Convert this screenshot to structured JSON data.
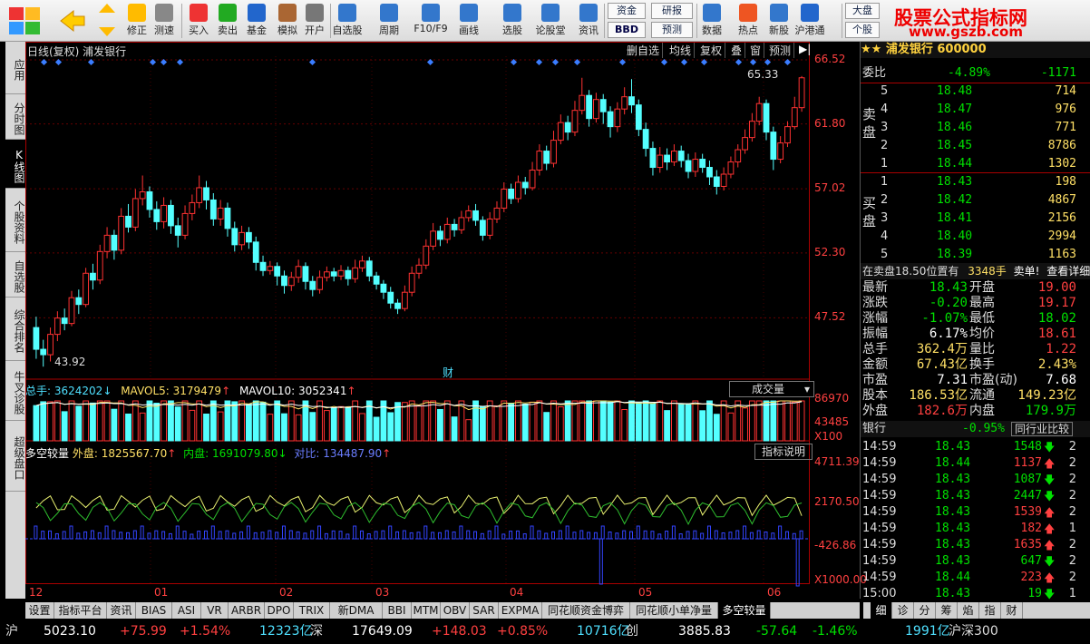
{
  "toolbar": {
    "buttons": [
      {
        "label": "修正",
        "icon": "refresh-icon"
      },
      {
        "label": "测速",
        "icon": "clock-icon"
      },
      {
        "label": "买入",
        "icon": "buy-icon"
      },
      {
        "label": "卖出",
        "icon": "sell-icon"
      },
      {
        "label": "基金",
        "icon": "fund-icon"
      },
      {
        "label": "模拟",
        "icon": "hammer-icon"
      },
      {
        "label": "开户",
        "icon": "lock-icon"
      },
      {
        "label": "自选股",
        "icon": "star-icon"
      },
      {
        "label": "周期",
        "icon": "period-icon"
      },
      {
        "label": "F10/F9",
        "icon": "f10-icon"
      },
      {
        "label": "画线",
        "icon": "pen-icon"
      },
      {
        "label": "选股",
        "icon": "select-icon"
      },
      {
        "label": "论股堂",
        "icon": "forum-icon"
      },
      {
        "label": "资讯",
        "icon": "news-icon"
      },
      {
        "label": "数据",
        "icon": "pe-icon"
      },
      {
        "label": "热点",
        "icon": "hot-icon"
      },
      {
        "label": "新股",
        "icon": "ipo-icon"
      },
      {
        "label": "沪港通",
        "icon": "hk-icon"
      }
    ],
    "small": {
      "zijin": "资金",
      "yanbao": "研报",
      "bbd": "BBD",
      "yuce": "预测",
      "dapan": "大盘",
      "gegu": "个股"
    },
    "brand_title": "股票公式指标网",
    "brand_url": "www.gszb.com"
  },
  "left_tabs": [
    {
      "label": "应用"
    },
    {
      "label": "分时图"
    },
    {
      "label": "K线图",
      "active": true
    },
    {
      "label": "个股资料"
    },
    {
      "label": "自选股"
    },
    {
      "label": "综合排名"
    },
    {
      "label": "牛叉诊股"
    },
    {
      "label": "超级盘口"
    }
  ],
  "chart_header": {
    "title": "日线(复权) 浦发银行",
    "menu": [
      "删自选",
      "均线",
      "复权",
      "叠",
      "窗",
      "预测"
    ]
  },
  "price_axis": [
    "66.52",
    "61.80",
    "57.02",
    "52.30",
    "47.52"
  ],
  "hi_label": "65.33",
  "lo_label": "43.92",
  "fin_mark": "财",
  "volume_header": {
    "total": "总手: 3624202",
    "mavol5": "MAVOL5: 3179479",
    "mavol10": "MAVOL10: 3052341",
    "selector": "成交量"
  },
  "vol_axis": [
    "86970",
    "43485",
    "X100"
  ],
  "ind_header": {
    "name": "多空较量",
    "outer": "外盘: 1825567.70",
    "inner": "内盘: 1691079.80",
    "diff": "对比: 134487.90",
    "explain": "指标说明"
  },
  "ind_axis": [
    "4711.39",
    "2170.50",
    "-426.86",
    "X1000.00"
  ],
  "month_labels": [
    "12",
    "01",
    "02",
    "03",
    "04",
    "05",
    "06"
  ],
  "bottom_tabs": [
    {
      "label": "设置"
    },
    {
      "label": "指标平台"
    },
    {
      "label": "资讯"
    },
    {
      "label": "BIAS"
    },
    {
      "label": "ASI"
    },
    {
      "label": "VR"
    },
    {
      "label": "ARBR"
    },
    {
      "label": "DPO"
    },
    {
      "label": "TRIX"
    },
    {
      "label": "新DMA"
    },
    {
      "label": "BBI"
    },
    {
      "label": "MTM"
    },
    {
      "label": "OBV"
    },
    {
      "label": "SAR"
    },
    {
      "label": "EXPMA"
    },
    {
      "label": "同花顺资金博弈"
    },
    {
      "label": "同花顺小单净量"
    },
    {
      "label": "多空较量",
      "active": true
    }
  ],
  "right_panel": {
    "title": "浦发银行 600000",
    "weibi": {
      "label": "委比",
      "pct": "-4.89%",
      "diff": "-1171"
    },
    "sell_label": "卖盘",
    "buy_label": "买盘",
    "asks": [
      {
        "n": "5",
        "p": "18.48",
        "v": "714"
      },
      {
        "n": "4",
        "p": "18.47",
        "v": "976"
      },
      {
        "n": "3",
        "p": "18.46",
        "v": "771"
      },
      {
        "n": "2",
        "p": "18.45",
        "v": "8786"
      },
      {
        "n": "1",
        "p": "18.44",
        "v": "1302"
      }
    ],
    "bids": [
      {
        "n": "1",
        "p": "18.43",
        "v": "198"
      },
      {
        "n": "2",
        "p": "18.42",
        "v": "4867"
      },
      {
        "n": "3",
        "p": "18.41",
        "v": "2156"
      },
      {
        "n": "4",
        "p": "18.40",
        "v": "2994"
      },
      {
        "n": "5",
        "p": "18.39",
        "v": "1163"
      }
    ],
    "info_line": {
      "a": "在卖盘18.50位置有",
      "b": "3348手",
      "c": "卖单!",
      "d": "查看详细"
    },
    "quote": [
      {
        "l1": "最新",
        "v1": "18.43",
        "c1": "green",
        "l2": "开盘",
        "v2": "19.00",
        "c2": "red"
      },
      {
        "l1": "涨跌",
        "v1": "-0.20",
        "c1": "green",
        "l2": "最高",
        "v2": "19.17",
        "c2": "red"
      },
      {
        "l1": "涨幅",
        "v1": "-1.07%",
        "c1": "green",
        "l2": "最低",
        "v2": "18.02",
        "c2": "green"
      },
      {
        "l1": "振幅",
        "v1": "6.17%",
        "c1": "white",
        "l2": "均价",
        "v2": "18.61",
        "c2": "red"
      },
      {
        "l1": "总手",
        "v1": "362.4万",
        "c1": "yellow",
        "l2": "量比",
        "v2": "1.22",
        "c2": "red"
      },
      {
        "l1": "金额",
        "v1": "67.43亿",
        "c1": "yellow",
        "l2": "换手",
        "v2": "2.43%",
        "c2": "yellow"
      },
      {
        "l1": "市盈",
        "v1": "7.31",
        "c1": "white",
        "l2": "市盈(动)",
        "v2": "7.68",
        "c2": "white"
      },
      {
        "l1": "股本",
        "v1": "186.53亿",
        "c1": "yellow",
        "l2": "流通",
        "v2": "149.23亿",
        "c2": "yellow"
      },
      {
        "l1": "外盘",
        "v1": "182.6万",
        "c1": "red",
        "l2": "内盘",
        "v2": "179.9万",
        "c2": "green"
      }
    ],
    "industry": {
      "name": "银行",
      "pct": "-0.95%",
      "btn": "同行业比较"
    },
    "ticks": [
      {
        "t": "14:59",
        "p": "18.43",
        "v": "1548",
        "d": "down",
        "n": "2"
      },
      {
        "t": "14:59",
        "p": "18.44",
        "v": "1137",
        "d": "up",
        "n": "2"
      },
      {
        "t": "14:59",
        "p": "18.43",
        "v": "1087",
        "d": "down",
        "n": "2"
      },
      {
        "t": "14:59",
        "p": "18.43",
        "v": "2447",
        "d": "down",
        "n": "2"
      },
      {
        "t": "14:59",
        "p": "18.43",
        "v": "1539",
        "d": "up",
        "n": "2"
      },
      {
        "t": "14:59",
        "p": "18.43",
        "v": "182",
        "d": "up",
        "n": "1"
      },
      {
        "t": "14:59",
        "p": "18.43",
        "v": "1635",
        "d": "up",
        "n": "2"
      },
      {
        "t": "14:59",
        "p": "18.43",
        "v": "647",
        "d": "down",
        "n": "2"
      },
      {
        "t": "14:59",
        "p": "18.44",
        "v": "223",
        "d": "up",
        "n": "2"
      },
      {
        "t": "15:00",
        "p": "18.43",
        "v": "19",
        "d": "down",
        "n": "1"
      }
    ],
    "tabs": [
      {
        "label": "细",
        "active": true
      },
      {
        "label": "诊"
      },
      {
        "label": "分"
      },
      {
        "label": "筹"
      },
      {
        "label": "焰"
      },
      {
        "label": "指"
      },
      {
        "label": "财"
      }
    ]
  },
  "status": {
    "sh": {
      "label": "沪",
      "index": "5023.10",
      "chg": "+75.99",
      "pct": "+1.54%",
      "amt": "12323亿"
    },
    "sz": {
      "label": "深",
      "index": "17649.09",
      "chg": "+148.03",
      "pct": "+0.85%",
      "amt": "10716亿"
    },
    "cy": {
      "label": "创",
      "index": "3885.83",
      "chg": "-57.64",
      "pct": "-1.46%",
      "amt": "1991亿"
    },
    "hs": {
      "label": "沪深300"
    }
  },
  "chart_data": {
    "type": "candlestick",
    "title": "日线(复权) 浦发银行",
    "ylim": [
      43.0,
      66.52
    ],
    "x_ticks": [
      "12",
      "01",
      "02",
      "03",
      "04",
      "05",
      "06"
    ],
    "candles": [
      [
        46.8,
        45.2,
        47.6,
        44.5
      ],
      [
        45.2,
        44.8,
        45.9,
        43.92
      ],
      [
        44.8,
        46.3,
        46.8,
        44.3
      ],
      [
        46.3,
        47.5,
        48.0,
        45.8
      ],
      [
        47.5,
        47.1,
        48.2,
        46.6
      ],
      [
        47.1,
        49.0,
        49.5,
        46.9
      ],
      [
        49.0,
        48.5,
        49.6,
        47.8
      ],
      [
        48.5,
        50.8,
        51.2,
        48.3
      ],
      [
        50.8,
        50.3,
        51.5,
        49.6
      ],
      [
        50.3,
        52.4,
        52.9,
        50.0
      ],
      [
        52.4,
        53.6,
        54.2,
        51.9
      ],
      [
        53.6,
        52.5,
        54.0,
        51.8
      ],
      [
        52.5,
        55.0,
        55.6,
        52.2
      ],
      [
        55.0,
        54.2,
        55.9,
        53.8
      ],
      [
        54.2,
        56.3,
        57.0,
        53.9
      ],
      [
        56.3,
        56.8,
        58.0,
        55.8
      ],
      [
        56.8,
        55.5,
        57.2,
        54.9
      ],
      [
        55.5,
        54.6,
        56.1,
        54.0
      ],
      [
        54.6,
        55.8,
        56.4,
        54.1
      ],
      [
        55.8,
        54.3,
        56.2,
        53.7
      ],
      [
        54.3,
        53.6,
        54.9,
        52.7
      ],
      [
        53.6,
        55.2,
        55.8,
        53.3
      ],
      [
        55.2,
        56.0,
        56.6,
        54.7
      ],
      [
        56.0,
        57.1,
        58.0,
        55.6
      ],
      [
        57.1,
        56.2,
        57.6,
        55.5
      ],
      [
        56.2,
        54.8,
        56.7,
        54.3
      ],
      [
        54.8,
        55.6,
        56.2,
        54.3
      ],
      [
        55.6,
        54.1,
        56.0,
        53.5
      ],
      [
        54.1,
        52.9,
        54.6,
        52.4
      ],
      [
        52.9,
        53.8,
        54.3,
        52.5
      ],
      [
        53.8,
        53.1,
        54.2,
        52.6
      ],
      [
        53.1,
        51.6,
        53.5,
        51.0
      ],
      [
        51.6,
        51.0,
        52.1,
        50.6
      ],
      [
        51.0,
        51.3,
        51.7,
        50.7
      ],
      [
        51.3,
        50.6,
        51.6,
        49.9
      ],
      [
        50.6,
        49.9,
        51.0,
        49.3
      ],
      [
        49.9,
        50.5,
        50.9,
        49.5
      ],
      [
        50.5,
        51.3,
        51.8,
        50.1
      ],
      [
        51.3,
        50.2,
        51.6,
        49.6
      ],
      [
        50.2,
        49.6,
        50.6,
        49.1
      ],
      [
        49.6,
        50.5,
        51.0,
        49.3
      ],
      [
        50.5,
        50.9,
        51.3,
        50.2
      ],
      [
        50.9,
        50.6,
        51.2,
        50.2
      ],
      [
        50.6,
        51.0,
        51.4,
        50.3
      ],
      [
        51.0,
        50.4,
        51.3,
        49.9
      ],
      [
        50.4,
        51.2,
        51.8,
        50.1
      ],
      [
        51.2,
        51.7,
        52.1,
        50.9
      ],
      [
        51.7,
        50.6,
        52.0,
        50.2
      ],
      [
        50.6,
        50.0,
        50.9,
        49.6
      ],
      [
        50.0,
        49.4,
        50.3,
        48.9
      ],
      [
        49.4,
        48.6,
        49.8,
        48.2
      ],
      [
        48.6,
        48.2,
        48.9,
        47.8
      ],
      [
        48.2,
        49.4,
        49.9,
        48.0
      ],
      [
        49.4,
        50.8,
        51.3,
        49.1
      ],
      [
        50.8,
        51.4,
        51.9,
        50.4
      ],
      [
        51.4,
        52.8,
        53.3,
        51.1
      ],
      [
        52.8,
        53.9,
        54.5,
        52.5
      ],
      [
        53.9,
        53.3,
        54.3,
        52.8
      ],
      [
        53.3,
        54.4,
        54.9,
        53.0
      ],
      [
        54.4,
        54.0,
        54.8,
        53.5
      ],
      [
        54.0,
        54.9,
        55.4,
        53.7
      ],
      [
        54.9,
        55.4,
        55.8,
        54.6
      ],
      [
        55.4,
        54.7,
        55.9,
        54.3
      ],
      [
        54.7,
        53.6,
        55.0,
        53.2
      ],
      [
        53.6,
        54.8,
        55.3,
        53.3
      ],
      [
        54.8,
        55.6,
        56.1,
        54.5
      ],
      [
        55.6,
        57.0,
        57.5,
        55.3
      ],
      [
        57.0,
        56.3,
        57.4,
        55.9
      ],
      [
        56.3,
        57.5,
        58.0,
        56.0
      ],
      [
        57.5,
        57.1,
        57.9,
        56.6
      ],
      [
        57.1,
        58.4,
        59.0,
        56.9
      ],
      [
        58.4,
        59.8,
        60.3,
        58.0
      ],
      [
        59.8,
        58.9,
        60.2,
        58.4
      ],
      [
        58.9,
        60.6,
        61.3,
        58.6
      ],
      [
        60.6,
        61.9,
        62.5,
        60.3
      ],
      [
        61.9,
        61.2,
        62.4,
        60.6
      ],
      [
        61.2,
        62.8,
        63.5,
        60.9
      ],
      [
        62.8,
        63.9,
        65.2,
        62.5
      ],
      [
        63.9,
        62.2,
        64.3,
        61.6
      ],
      [
        62.2,
        63.6,
        64.1,
        61.9
      ],
      [
        63.6,
        62.7,
        64.0,
        61.8
      ],
      [
        62.7,
        61.6,
        63.1,
        60.8
      ],
      [
        61.6,
        62.9,
        63.4,
        61.2
      ],
      [
        62.9,
        63.8,
        64.5,
        62.5
      ],
      [
        63.8,
        63.2,
        65.1,
        62.6
      ],
      [
        63.2,
        61.4,
        63.6,
        60.9
      ],
      [
        61.4,
        60.0,
        61.9,
        59.4
      ],
      [
        60.0,
        58.6,
        60.5,
        58.0
      ],
      [
        58.6,
        59.5,
        60.1,
        58.2
      ],
      [
        59.5,
        59.0,
        60.0,
        58.4
      ],
      [
        59.0,
        59.8,
        60.3,
        58.7
      ],
      [
        59.8,
        59.1,
        60.2,
        58.6
      ],
      [
        59.1,
        58.3,
        59.6,
        57.8
      ],
      [
        58.3,
        59.2,
        59.7,
        57.9
      ],
      [
        59.2,
        58.6,
        59.6,
        58.2
      ],
      [
        58.6,
        57.9,
        59.1,
        57.3
      ],
      [
        57.9,
        57.2,
        58.4,
        56.6
      ],
      [
        57.2,
        58.1,
        58.6,
        56.9
      ],
      [
        58.1,
        59.0,
        59.4,
        57.8
      ],
      [
        59.0,
        59.9,
        60.3,
        58.6
      ],
      [
        59.9,
        60.8,
        61.4,
        59.6
      ],
      [
        60.8,
        62.0,
        62.6,
        60.5
      ],
      [
        62.0,
        63.3,
        63.8,
        61.7
      ],
      [
        63.3,
        61.2,
        63.6,
        60.6
      ],
      [
        61.2,
        59.2,
        61.6,
        58.4
      ],
      [
        59.2,
        60.4,
        60.9,
        58.9
      ],
      [
        60.4,
        61.6,
        62.0,
        60.1
      ],
      [
        61.6,
        63.0,
        63.8,
        61.4
      ],
      [
        63.0,
        65.2,
        65.33,
        62.7
      ]
    ]
  }
}
